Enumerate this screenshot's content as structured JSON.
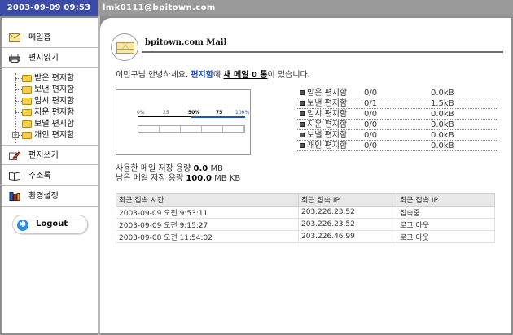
{
  "header": {
    "datetime": "2003-09-09 09:53",
    "user_email": "lmk0111@bpitown.com"
  },
  "sidebar": {
    "items": [
      {
        "label": "메일홈",
        "icon": "envelope-icon"
      },
      {
        "label": "편지읽기",
        "icon": "printer-icon"
      }
    ],
    "folders": [
      {
        "label": "받은 편지함"
      },
      {
        "label": "보낸 편지함"
      },
      {
        "label": "임시 편지함"
      },
      {
        "label": "지운 편지함"
      },
      {
        "label": "보낼 편지함"
      },
      {
        "label": "개인 편지함"
      }
    ],
    "bottom_items": [
      {
        "label": "편지쓰기",
        "icon": "pencil-icon"
      },
      {
        "label": "주소록",
        "icon": "book-icon"
      },
      {
        "label": "환경설정",
        "icon": "tools-icon"
      }
    ],
    "logout_label": "Logout"
  },
  "mail": {
    "title": "bpitown.com Mail",
    "greeting": {
      "part1": "이민구님 안녕하세요. ",
      "folder": "편지함",
      "part2": "에 ",
      "new_label": "새 메일 0 통",
      "part3": "이 있습니다."
    }
  },
  "meter": {
    "ticks": [
      "0%",
      "25",
      "50%",
      "75",
      "100%"
    ],
    "fill_fraction": 0.0
  },
  "usage": {
    "used_label": "사용한 메일 저장 용량",
    "used_value": "0.0",
    "used_unit": "MB",
    "remain_label": "남은 메일 저장 용량",
    "remain_value": "100.0",
    "remain_unit": "MB KB"
  },
  "folder_summary": [
    {
      "name": "받은 편지함",
      "count": "0/0",
      "size": "0.0kB"
    },
    {
      "name": "보낸 편지함",
      "count": "0/1",
      "size": "1.5kB"
    },
    {
      "name": "임시 편지함",
      "count": "0/0",
      "size": "0.0kB"
    },
    {
      "name": "지운 편지함",
      "count": "0/0",
      "size": "0.0kB"
    },
    {
      "name": "보낼 편지함",
      "count": "0/0",
      "size": "0.0kB"
    },
    {
      "name": "개인 편지함",
      "count": "0/0",
      "size": "0.0kB"
    }
  ],
  "access_table": {
    "headers": [
      "최근 접속 시간",
      "최근 접속 IP",
      "최근 접속 IP"
    ],
    "rows": [
      [
        "2003-09-09 오전 9:53:11",
        "203.226.23.52",
        "접속중"
      ],
      [
        "2003-09-09 오전 9:15:27",
        "203.226.23.52",
        "로그 아웃"
      ],
      [
        "2003-09-08 오전 11:54:02",
        "203.226.46.99",
        "로그 아웃"
      ]
    ]
  },
  "colors": {
    "accent": "#3b4ba7",
    "link": "#1d4fcf",
    "folder": "#f5cf47"
  }
}
